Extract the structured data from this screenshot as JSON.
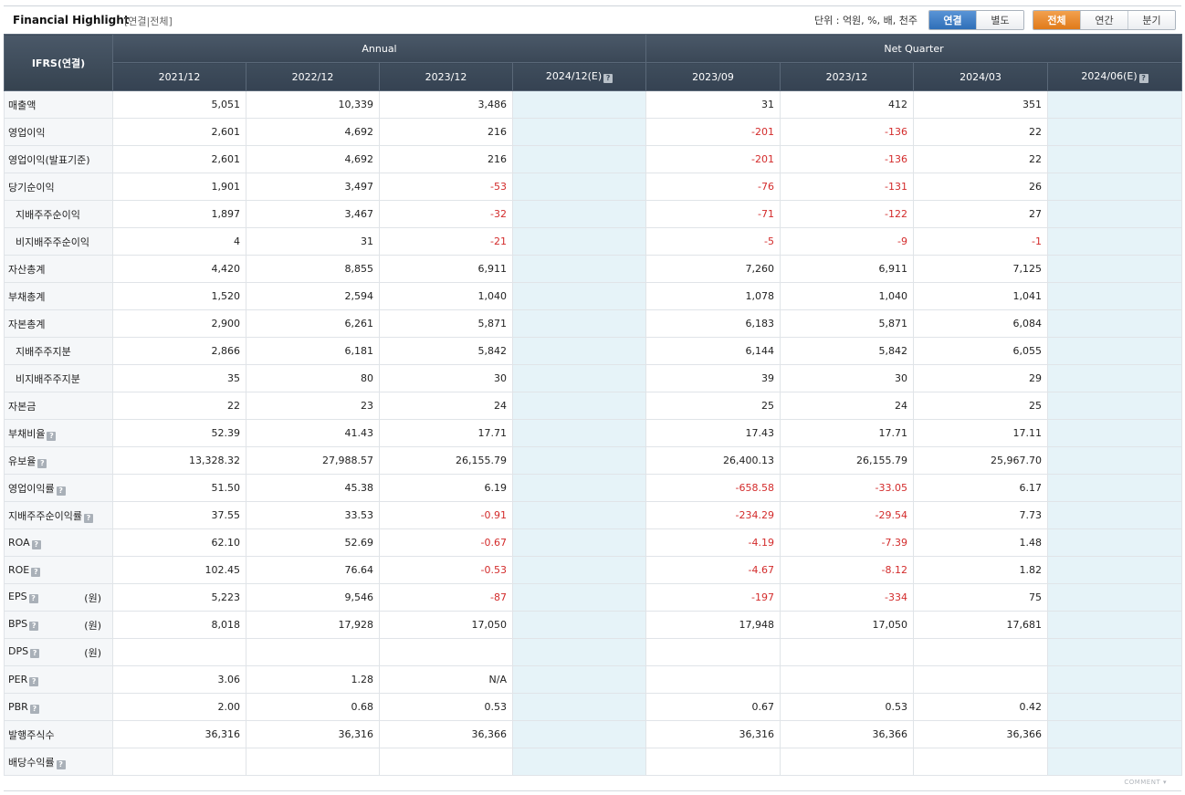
{
  "header": {
    "title": "Financial Highlight",
    "subtitle": "[연결|전체]",
    "unit_label": "단위 : 억원, %, 배, 천주",
    "basis_buttons": [
      "연결",
      "별도"
    ],
    "period_buttons": [
      "전체",
      "연간",
      "분기"
    ]
  },
  "table": {
    "row_header": "IFRS(연결)",
    "group_annual": "Annual",
    "group_quarter": "Net Quarter",
    "columns": [
      "2021/12",
      "2022/12",
      "2023/12",
      "2024/12(E)",
      "2023/09",
      "2023/12",
      "2024/03",
      "2024/06(E)"
    ],
    "rows": [
      {
        "label": "매출액",
        "values": [
          "5,051",
          "10,339",
          "3,486",
          "",
          "31",
          "412",
          "351",
          ""
        ]
      },
      {
        "label": "영업이익",
        "values": [
          "2,601",
          "4,692",
          "216",
          "",
          "-201",
          "-136",
          "22",
          ""
        ]
      },
      {
        "label": "영업이익(발표기준)",
        "values": [
          "2,601",
          "4,692",
          "216",
          "",
          "-201",
          "-136",
          "22",
          ""
        ]
      },
      {
        "label": "당기순이익",
        "values": [
          "1,901",
          "3,497",
          "-53",
          "",
          "-76",
          "-131",
          "26",
          ""
        ]
      },
      {
        "label": "지배주주순이익",
        "values": [
          "1,897",
          "3,467",
          "-32",
          "",
          "-71",
          "-122",
          "27",
          ""
        ]
      },
      {
        "label": "비지배주주순이익",
        "values": [
          "4",
          "31",
          "-21",
          "",
          "-5",
          "-9",
          "-1",
          ""
        ]
      },
      {
        "label": "자산총계",
        "values": [
          "4,420",
          "8,855",
          "6,911",
          "",
          "7,260",
          "6,911",
          "7,125",
          ""
        ]
      },
      {
        "label": "부채총계",
        "values": [
          "1,520",
          "2,594",
          "1,040",
          "",
          "1,078",
          "1,040",
          "1,041",
          ""
        ]
      },
      {
        "label": "자본총계",
        "values": [
          "2,900",
          "6,261",
          "5,871",
          "",
          "6,183",
          "5,871",
          "6,084",
          ""
        ]
      },
      {
        "label": "지배주주지분",
        "values": [
          "2,866",
          "6,181",
          "5,842",
          "",
          "6,144",
          "5,842",
          "6,055",
          ""
        ]
      },
      {
        "label": "비지배주주지분",
        "values": [
          "35",
          "80",
          "30",
          "",
          "39",
          "30",
          "29",
          ""
        ]
      },
      {
        "label": "자본금",
        "values": [
          "22",
          "23",
          "24",
          "",
          "25",
          "24",
          "25",
          ""
        ]
      },
      {
        "label": "부채비율",
        "values": [
          "52.39",
          "41.43",
          "17.71",
          "",
          "17.43",
          "17.71",
          "17.11",
          ""
        ]
      },
      {
        "label": "유보율",
        "values": [
          "13,328.32",
          "27,988.57",
          "26,155.79",
          "",
          "26,400.13",
          "26,155.79",
          "25,967.70",
          ""
        ]
      },
      {
        "label": "영업이익률",
        "values": [
          "51.50",
          "45.38",
          "6.19",
          "",
          "-658.58",
          "-33.05",
          "6.17",
          ""
        ]
      },
      {
        "label": "지배주주순이익률",
        "values": [
          "37.55",
          "33.53",
          "-0.91",
          "",
          "-234.29",
          "-29.54",
          "7.73",
          ""
        ]
      },
      {
        "label": "ROA",
        "values": [
          "62.10",
          "52.69",
          "-0.67",
          "",
          "-4.19",
          "-7.39",
          "1.48",
          ""
        ]
      },
      {
        "label": "ROE",
        "values": [
          "102.45",
          "76.64",
          "-0.53",
          "",
          "-4.67",
          "-8.12",
          "1.82",
          ""
        ]
      },
      {
        "label": "EPS",
        "unit": "(원)",
        "values": [
          "5,223",
          "9,546",
          "-87",
          "",
          "-197",
          "-334",
          "75",
          ""
        ]
      },
      {
        "label": "BPS",
        "unit": "(원)",
        "values": [
          "8,018",
          "17,928",
          "17,050",
          "",
          "17,948",
          "17,050",
          "17,681",
          ""
        ]
      },
      {
        "label": "DPS",
        "unit": "(원)",
        "values": [
          "",
          "",
          "",
          "",
          "",
          "",
          "",
          ""
        ]
      },
      {
        "label": "PER",
        "values": [
          "3.06",
          "1.28",
          "N/A",
          "",
          "",
          "",
          "",
          ""
        ]
      },
      {
        "label": "PBR",
        "values": [
          "2.00",
          "0.68",
          "0.53",
          "",
          "0.67",
          "0.53",
          "0.42",
          ""
        ]
      },
      {
        "label": "발행주식수",
        "values": [
          "36,316",
          "36,316",
          "36,366",
          "",
          "36,316",
          "36,366",
          "36,366",
          ""
        ]
      },
      {
        "label": "배당수익률",
        "values": [
          "",
          "",
          "",
          "",
          "",
          "",
          "",
          ""
        ]
      }
    ]
  },
  "footer": {
    "comment_label": "COMMENT"
  },
  "colors": {
    "header_bg": "#3f4d5c",
    "negative": "#d32b2b",
    "estimate_bg": "#e6f3f8",
    "active_basis": "#2f6fb8",
    "active_period": "#e07a1a"
  }
}
